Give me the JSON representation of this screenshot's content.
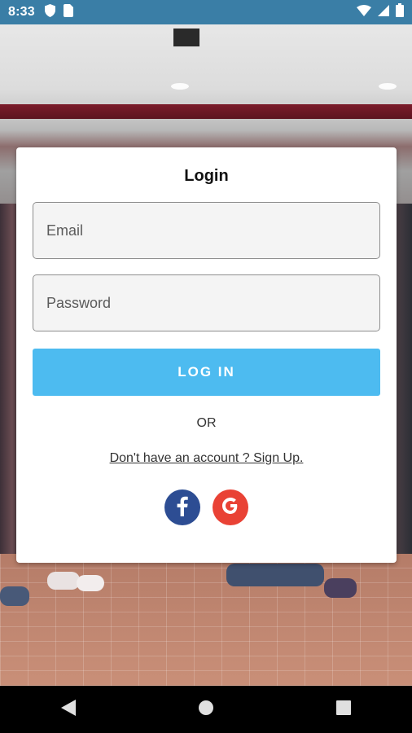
{
  "status_bar": {
    "time": "8:33",
    "left_icons": [
      "shield-icon",
      "sim-card-icon"
    ],
    "right_icons": [
      "wifi-icon",
      "cell-signal-icon",
      "battery-icon"
    ]
  },
  "login_card": {
    "title": "Login",
    "email_placeholder": "Email",
    "password_placeholder": "Password",
    "login_button_label": "LOG IN",
    "or_text": "OR",
    "signup_link": "Don't have an account ? Sign Up.",
    "social_buttons": [
      {
        "name": "facebook-icon",
        "color": "#2d4d93"
      },
      {
        "name": "google-icon",
        "color": "#e94235"
      }
    ]
  },
  "nav_bar": {
    "buttons": [
      "back-icon",
      "home-icon",
      "recents-icon"
    ]
  },
  "colors": {
    "status_bar": "#3a7ea6",
    "login_button": "#4dbbf0"
  }
}
